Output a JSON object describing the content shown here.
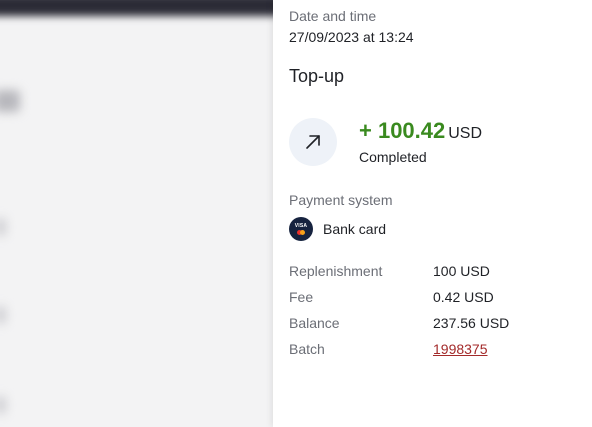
{
  "transaction": {
    "datetime_label": "Date and time",
    "datetime_value": "27/09/2023 at 13:24",
    "title": "Top-up",
    "direction_icon": "arrow-up-right-icon",
    "amount": "+ 100.42",
    "currency": "USD",
    "status": "Completed",
    "amount_color": "#3a8a1f"
  },
  "payment_system": {
    "label": "Payment system",
    "icon": "bank-card-icon",
    "name": "Bank card"
  },
  "details": [
    {
      "key": "Replenishment",
      "value": "100 USD"
    },
    {
      "key": "Fee",
      "value": "0.42 USD"
    },
    {
      "key": "Balance",
      "value": "237.56 USD"
    },
    {
      "key": "Batch",
      "value": "1998375"
    }
  ]
}
